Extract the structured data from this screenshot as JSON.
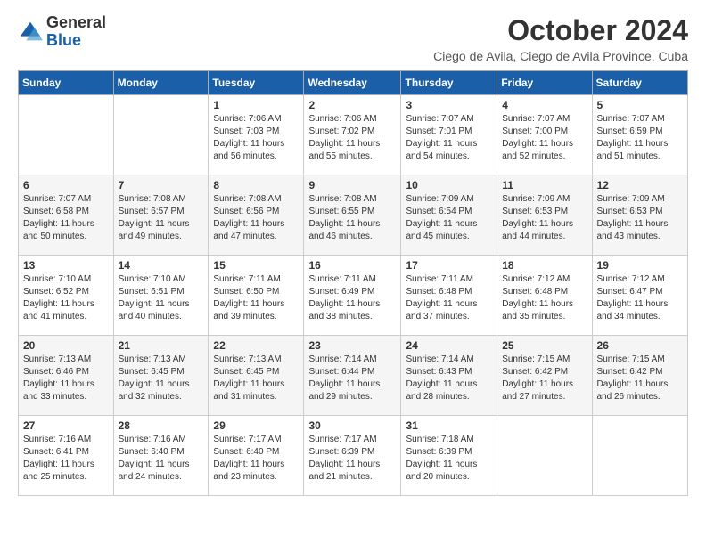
{
  "logo": {
    "general": "General",
    "blue": "Blue"
  },
  "title": "October 2024",
  "location": "Ciego de Avila, Ciego de Avila Province, Cuba",
  "days_of_week": [
    "Sunday",
    "Monday",
    "Tuesday",
    "Wednesday",
    "Thursday",
    "Friday",
    "Saturday"
  ],
  "weeks": [
    [
      {
        "day": null,
        "sunrise": null,
        "sunset": null,
        "daylight": null
      },
      {
        "day": null,
        "sunrise": null,
        "sunset": null,
        "daylight": null
      },
      {
        "day": "1",
        "sunrise": "Sunrise: 7:06 AM",
        "sunset": "Sunset: 7:03 PM",
        "daylight": "Daylight: 11 hours and 56 minutes."
      },
      {
        "day": "2",
        "sunrise": "Sunrise: 7:06 AM",
        "sunset": "Sunset: 7:02 PM",
        "daylight": "Daylight: 11 hours and 55 minutes."
      },
      {
        "day": "3",
        "sunrise": "Sunrise: 7:07 AM",
        "sunset": "Sunset: 7:01 PM",
        "daylight": "Daylight: 11 hours and 54 minutes."
      },
      {
        "day": "4",
        "sunrise": "Sunrise: 7:07 AM",
        "sunset": "Sunset: 7:00 PM",
        "daylight": "Daylight: 11 hours and 52 minutes."
      },
      {
        "day": "5",
        "sunrise": "Sunrise: 7:07 AM",
        "sunset": "Sunset: 6:59 PM",
        "daylight": "Daylight: 11 hours and 51 minutes."
      }
    ],
    [
      {
        "day": "6",
        "sunrise": "Sunrise: 7:07 AM",
        "sunset": "Sunset: 6:58 PM",
        "daylight": "Daylight: 11 hours and 50 minutes."
      },
      {
        "day": "7",
        "sunrise": "Sunrise: 7:08 AM",
        "sunset": "Sunset: 6:57 PM",
        "daylight": "Daylight: 11 hours and 49 minutes."
      },
      {
        "day": "8",
        "sunrise": "Sunrise: 7:08 AM",
        "sunset": "Sunset: 6:56 PM",
        "daylight": "Daylight: 11 hours and 47 minutes."
      },
      {
        "day": "9",
        "sunrise": "Sunrise: 7:08 AM",
        "sunset": "Sunset: 6:55 PM",
        "daylight": "Daylight: 11 hours and 46 minutes."
      },
      {
        "day": "10",
        "sunrise": "Sunrise: 7:09 AM",
        "sunset": "Sunset: 6:54 PM",
        "daylight": "Daylight: 11 hours and 45 minutes."
      },
      {
        "day": "11",
        "sunrise": "Sunrise: 7:09 AM",
        "sunset": "Sunset: 6:53 PM",
        "daylight": "Daylight: 11 hours and 44 minutes."
      },
      {
        "day": "12",
        "sunrise": "Sunrise: 7:09 AM",
        "sunset": "Sunset: 6:53 PM",
        "daylight": "Daylight: 11 hours and 43 minutes."
      }
    ],
    [
      {
        "day": "13",
        "sunrise": "Sunrise: 7:10 AM",
        "sunset": "Sunset: 6:52 PM",
        "daylight": "Daylight: 11 hours and 41 minutes."
      },
      {
        "day": "14",
        "sunrise": "Sunrise: 7:10 AM",
        "sunset": "Sunset: 6:51 PM",
        "daylight": "Daylight: 11 hours and 40 minutes."
      },
      {
        "day": "15",
        "sunrise": "Sunrise: 7:11 AM",
        "sunset": "Sunset: 6:50 PM",
        "daylight": "Daylight: 11 hours and 39 minutes."
      },
      {
        "day": "16",
        "sunrise": "Sunrise: 7:11 AM",
        "sunset": "Sunset: 6:49 PM",
        "daylight": "Daylight: 11 hours and 38 minutes."
      },
      {
        "day": "17",
        "sunrise": "Sunrise: 7:11 AM",
        "sunset": "Sunset: 6:48 PM",
        "daylight": "Daylight: 11 hours and 37 minutes."
      },
      {
        "day": "18",
        "sunrise": "Sunrise: 7:12 AM",
        "sunset": "Sunset: 6:48 PM",
        "daylight": "Daylight: 11 hours and 35 minutes."
      },
      {
        "day": "19",
        "sunrise": "Sunrise: 7:12 AM",
        "sunset": "Sunset: 6:47 PM",
        "daylight": "Daylight: 11 hours and 34 minutes."
      }
    ],
    [
      {
        "day": "20",
        "sunrise": "Sunrise: 7:13 AM",
        "sunset": "Sunset: 6:46 PM",
        "daylight": "Daylight: 11 hours and 33 minutes."
      },
      {
        "day": "21",
        "sunrise": "Sunrise: 7:13 AM",
        "sunset": "Sunset: 6:45 PM",
        "daylight": "Daylight: 11 hours and 32 minutes."
      },
      {
        "day": "22",
        "sunrise": "Sunrise: 7:13 AM",
        "sunset": "Sunset: 6:45 PM",
        "daylight": "Daylight: 11 hours and 31 minutes."
      },
      {
        "day": "23",
        "sunrise": "Sunrise: 7:14 AM",
        "sunset": "Sunset: 6:44 PM",
        "daylight": "Daylight: 11 hours and 29 minutes."
      },
      {
        "day": "24",
        "sunrise": "Sunrise: 7:14 AM",
        "sunset": "Sunset: 6:43 PM",
        "daylight": "Daylight: 11 hours and 28 minutes."
      },
      {
        "day": "25",
        "sunrise": "Sunrise: 7:15 AM",
        "sunset": "Sunset: 6:42 PM",
        "daylight": "Daylight: 11 hours and 27 minutes."
      },
      {
        "day": "26",
        "sunrise": "Sunrise: 7:15 AM",
        "sunset": "Sunset: 6:42 PM",
        "daylight": "Daylight: 11 hours and 26 minutes."
      }
    ],
    [
      {
        "day": "27",
        "sunrise": "Sunrise: 7:16 AM",
        "sunset": "Sunset: 6:41 PM",
        "daylight": "Daylight: 11 hours and 25 minutes."
      },
      {
        "day": "28",
        "sunrise": "Sunrise: 7:16 AM",
        "sunset": "Sunset: 6:40 PM",
        "daylight": "Daylight: 11 hours and 24 minutes."
      },
      {
        "day": "29",
        "sunrise": "Sunrise: 7:17 AM",
        "sunset": "Sunset: 6:40 PM",
        "daylight": "Daylight: 11 hours and 23 minutes."
      },
      {
        "day": "30",
        "sunrise": "Sunrise: 7:17 AM",
        "sunset": "Sunset: 6:39 PM",
        "daylight": "Daylight: 11 hours and 21 minutes."
      },
      {
        "day": "31",
        "sunrise": "Sunrise: 7:18 AM",
        "sunset": "Sunset: 6:39 PM",
        "daylight": "Daylight: 11 hours and 20 minutes."
      },
      {
        "day": null,
        "sunrise": null,
        "sunset": null,
        "daylight": null
      },
      {
        "day": null,
        "sunrise": null,
        "sunset": null,
        "daylight": null
      }
    ]
  ]
}
